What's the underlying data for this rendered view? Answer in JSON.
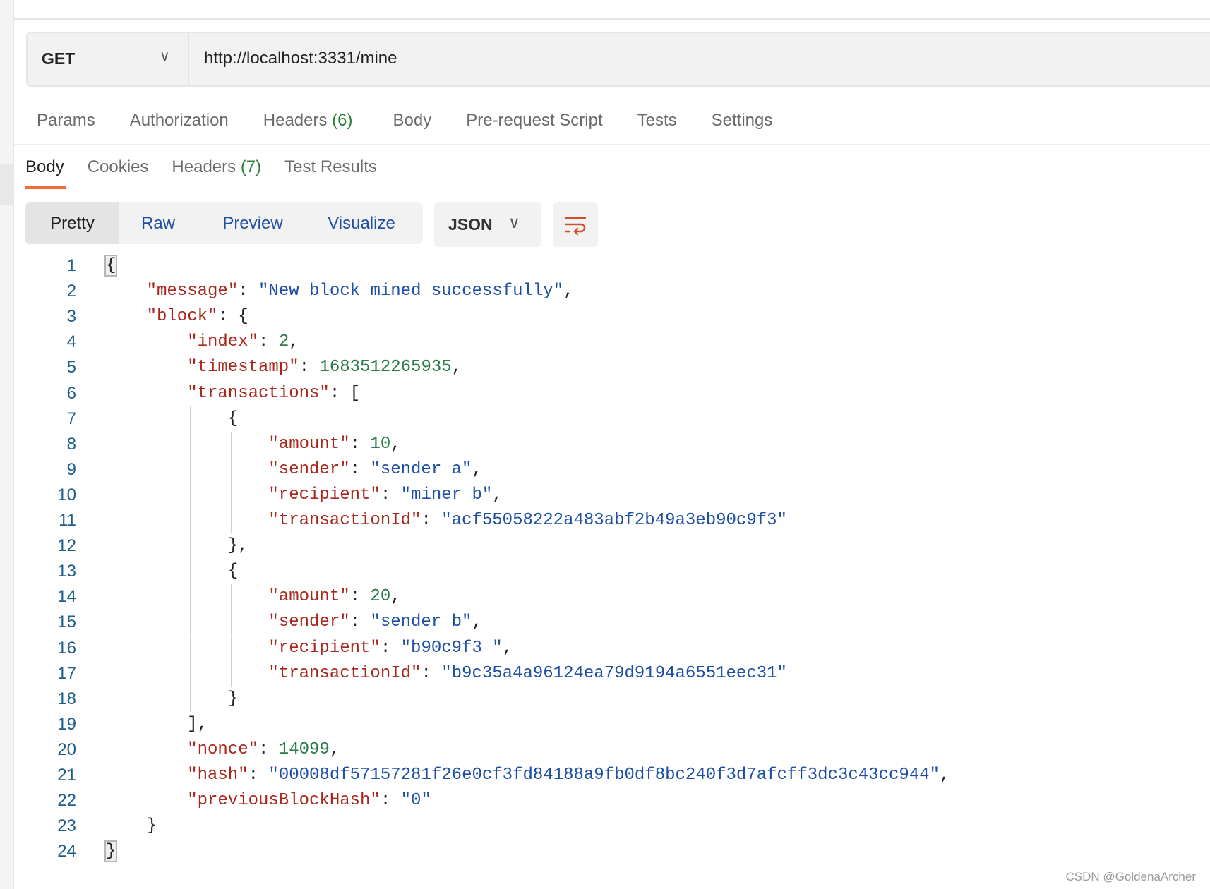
{
  "request": {
    "method": "GET",
    "url": "http://localhost:3331/mine"
  },
  "request_tabs": [
    {
      "label": "Params"
    },
    {
      "label": "Authorization"
    },
    {
      "label": "Headers",
      "count": "(6)"
    },
    {
      "label": "Body"
    },
    {
      "label": "Pre-request Script"
    },
    {
      "label": "Tests"
    },
    {
      "label": "Settings"
    }
  ],
  "response_tabs": [
    {
      "label": "Body",
      "active": true
    },
    {
      "label": "Cookies"
    },
    {
      "label": "Headers",
      "count": "(7)"
    },
    {
      "label": "Test Results"
    }
  ],
  "view_modes": [
    {
      "label": "Pretty",
      "active": true
    },
    {
      "label": "Raw"
    },
    {
      "label": "Preview"
    },
    {
      "label": "Visualize"
    }
  ],
  "format": "JSON",
  "wrap_icon": "wrap-lines-icon",
  "colors": {
    "accent": "#ef6c3f",
    "key": "#a8261c",
    "string": "#1f4fa5",
    "number": "#2b7a4b",
    "line_number": "#1e5e8b"
  },
  "code_lines": [
    {
      "indent": 0,
      "tokens": [
        [
          "p",
          "{"
        ]
      ],
      "match": true
    },
    {
      "indent": 1,
      "tokens": [
        [
          "k",
          "\"message\""
        ],
        [
          "p",
          ": "
        ],
        [
          "s",
          "\"New block mined successfully\""
        ],
        [
          "p",
          ","
        ]
      ]
    },
    {
      "indent": 1,
      "tokens": [
        [
          "k",
          "\"block\""
        ],
        [
          "p",
          ": {"
        ]
      ]
    },
    {
      "indent": 2,
      "tokens": [
        [
          "k",
          "\"index\""
        ],
        [
          "p",
          ": "
        ],
        [
          "n",
          "2"
        ],
        [
          "p",
          ","
        ]
      ]
    },
    {
      "indent": 2,
      "tokens": [
        [
          "k",
          "\"timestamp\""
        ],
        [
          "p",
          ": "
        ],
        [
          "n",
          "1683512265935"
        ],
        [
          "p",
          ","
        ]
      ]
    },
    {
      "indent": 2,
      "tokens": [
        [
          "k",
          "\"transactions\""
        ],
        [
          "p",
          ": ["
        ]
      ]
    },
    {
      "indent": 3,
      "tokens": [
        [
          "p",
          "{"
        ]
      ]
    },
    {
      "indent": 4,
      "tokens": [
        [
          "k",
          "\"amount\""
        ],
        [
          "p",
          ": "
        ],
        [
          "n",
          "10"
        ],
        [
          "p",
          ","
        ]
      ]
    },
    {
      "indent": 4,
      "tokens": [
        [
          "k",
          "\"sender\""
        ],
        [
          "p",
          ": "
        ],
        [
          "s",
          "\"sender a\""
        ],
        [
          "p",
          ","
        ]
      ]
    },
    {
      "indent": 4,
      "tokens": [
        [
          "k",
          "\"recipient\""
        ],
        [
          "p",
          ": "
        ],
        [
          "s",
          "\"miner b\""
        ],
        [
          "p",
          ","
        ]
      ]
    },
    {
      "indent": 4,
      "tokens": [
        [
          "k",
          "\"transactionId\""
        ],
        [
          "p",
          ": "
        ],
        [
          "s",
          "\"acf55058222a483abf2b49a3eb90c9f3\""
        ]
      ]
    },
    {
      "indent": 3,
      "tokens": [
        [
          "p",
          "},"
        ]
      ]
    },
    {
      "indent": 3,
      "tokens": [
        [
          "p",
          "{"
        ]
      ]
    },
    {
      "indent": 4,
      "tokens": [
        [
          "k",
          "\"amount\""
        ],
        [
          "p",
          ": "
        ],
        [
          "n",
          "20"
        ],
        [
          "p",
          ","
        ]
      ]
    },
    {
      "indent": 4,
      "tokens": [
        [
          "k",
          "\"sender\""
        ],
        [
          "p",
          ": "
        ],
        [
          "s",
          "\"sender b\""
        ],
        [
          "p",
          ","
        ]
      ]
    },
    {
      "indent": 4,
      "tokens": [
        [
          "k",
          "\"recipient\""
        ],
        [
          "p",
          ": "
        ],
        [
          "s",
          "\"b90c9f3 \""
        ],
        [
          "p",
          ","
        ]
      ]
    },
    {
      "indent": 4,
      "tokens": [
        [
          "k",
          "\"transactionId\""
        ],
        [
          "p",
          ": "
        ],
        [
          "s",
          "\"b9c35a4a96124ea79d9194a6551eec31\""
        ]
      ]
    },
    {
      "indent": 3,
      "tokens": [
        [
          "p",
          "}"
        ]
      ]
    },
    {
      "indent": 2,
      "tokens": [
        [
          "p",
          "],"
        ]
      ]
    },
    {
      "indent": 2,
      "tokens": [
        [
          "k",
          "\"nonce\""
        ],
        [
          "p",
          ": "
        ],
        [
          "n",
          "14099"
        ],
        [
          "p",
          ","
        ]
      ]
    },
    {
      "indent": 2,
      "tokens": [
        [
          "k",
          "\"hash\""
        ],
        [
          "p",
          ": "
        ],
        [
          "s",
          "\"00008df57157281f26e0cf3fd84188a9fb0df8bc240f3d7afcff3dc3c43cc944\""
        ],
        [
          "p",
          ","
        ]
      ]
    },
    {
      "indent": 2,
      "tokens": [
        [
          "k",
          "\"previousBlockHash\""
        ],
        [
          "p",
          ": "
        ],
        [
          "s",
          "\"0\""
        ]
      ]
    },
    {
      "indent": 1,
      "tokens": [
        [
          "p",
          "}"
        ]
      ]
    },
    {
      "indent": 0,
      "tokens": [
        [
          "p",
          "}"
        ]
      ],
      "match": true
    }
  ],
  "watermark": "CSDN @GoldenaArcher"
}
